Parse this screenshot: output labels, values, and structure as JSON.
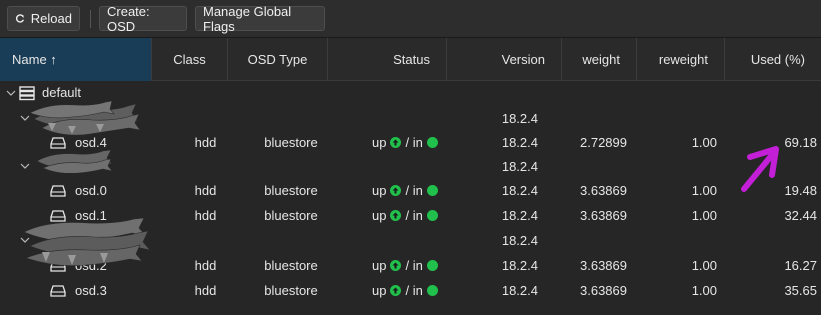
{
  "toolbar": {
    "reload_label": "Reload",
    "create_label": "Create: OSD",
    "flags_label": "Manage Global Flags"
  },
  "columns": {
    "name": "Name ↑",
    "class": "Class",
    "osd_type": "OSD Type",
    "status": "Status",
    "version": "Version",
    "weight": "weight",
    "reweight": "reweight",
    "used": "Used (%)"
  },
  "tree": {
    "root": {
      "name": "default"
    },
    "host1": {
      "version": "18.2.4"
    },
    "host2": {
      "version": "18.2.4"
    },
    "host3": {
      "version": "18.2.4"
    }
  },
  "osds": [
    {
      "name": "osd.4",
      "class": "hdd",
      "type": "bluestore",
      "status_up": "up",
      "status_in": "/ in",
      "version": "18.2.4",
      "weight": "2.72899",
      "reweight": "1.00",
      "used": "69.18"
    },
    {
      "name": "osd.0",
      "class": "hdd",
      "type": "bluestore",
      "status_up": "up",
      "status_in": "/ in",
      "version": "18.2.4",
      "weight": "3.63869",
      "reweight": "1.00",
      "used": "19.48"
    },
    {
      "name": "osd.1",
      "class": "hdd",
      "type": "bluestore",
      "status_up": "up",
      "status_in": "/ in",
      "version": "18.2.4",
      "weight": "3.63869",
      "reweight": "1.00",
      "used": "32.44"
    },
    {
      "name": "osd.2",
      "class": "hdd",
      "type": "bluestore",
      "status_up": "up",
      "status_in": "/ in",
      "version": "18.2.4",
      "weight": "3.63869",
      "reweight": "1.00",
      "used": "16.27"
    },
    {
      "name": "osd.3",
      "class": "hdd",
      "type": "bluestore",
      "status_up": "up",
      "status_in": "/ in",
      "version": "18.2.4",
      "weight": "3.63869",
      "reweight": "1.00",
      "used": "35.65"
    }
  ],
  "icons": {
    "reload": "refresh-icon",
    "status_up": "arrow-up-circle-icon",
    "status_in": "green-dot-icon",
    "disk": "hdd-icon",
    "server": "server-icon"
  },
  "colors": {
    "sorted_header": "#1a3d57",
    "ok": "#21bf4b",
    "annotation": "#c21fd6"
  }
}
